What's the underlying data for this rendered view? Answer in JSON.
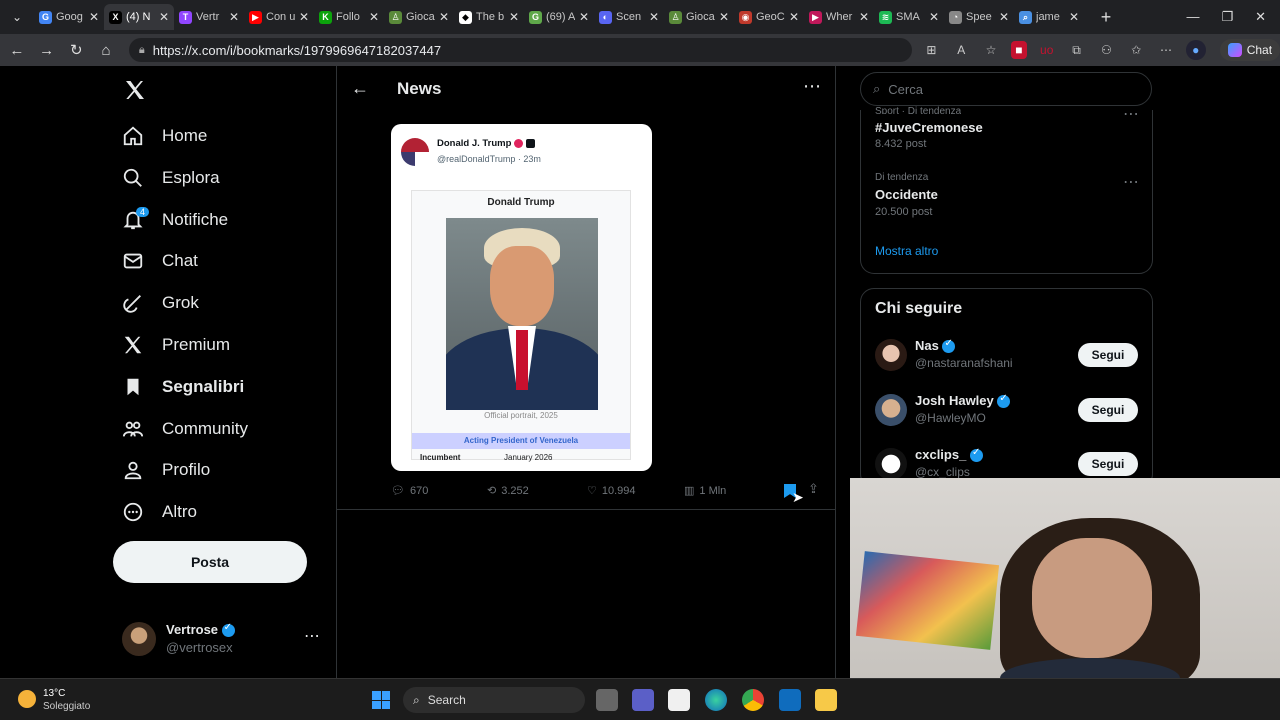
{
  "browser": {
    "tabs": [
      {
        "title": "Goog",
        "color": "#4285f4",
        "glyph": "G"
      },
      {
        "title": "(4) N",
        "color": "#000000",
        "glyph": "X",
        "active": true
      },
      {
        "title": "Vertr",
        "color": "#9146ff",
        "glyph": "T"
      },
      {
        "title": "Con u",
        "color": "#ff0000",
        "glyph": "▶"
      },
      {
        "title": "Follo",
        "color": "#0ca30c",
        "glyph": "K"
      },
      {
        "title": "Gioca",
        "color": "#5a8a3a",
        "glyph": "♙"
      },
      {
        "title": "The b",
        "color": "#ffffff",
        "glyph": "◆"
      },
      {
        "title": "(69) A",
        "color": "#5fa84a",
        "glyph": "G"
      },
      {
        "title": "Scen",
        "color": "#5865f2",
        "glyph": "◐"
      },
      {
        "title": "Gioca",
        "color": "#5a8a3a",
        "glyph": "♙"
      },
      {
        "title": "GeoC",
        "color": "#c0392b",
        "glyph": "◉"
      },
      {
        "title": "Wher",
        "color": "#c0185a",
        "glyph": "▶"
      },
      {
        "title": "SMA",
        "color": "#1db954",
        "glyph": "≋"
      },
      {
        "title": "Spee",
        "color": "#888888",
        "glyph": "◔"
      },
      {
        "title": "jame",
        "color": "#4a90e2",
        "glyph": "⌕"
      }
    ],
    "url": "https://x.com/i/bookmarks/1979969647182037447",
    "chat_label": "Chat"
  },
  "sidebar": {
    "items": [
      {
        "label": "Home",
        "icon": "home-icon"
      },
      {
        "label": "Esplora",
        "icon": "search-icon"
      },
      {
        "label": "Notifiche",
        "icon": "bell-icon",
        "badge": "4"
      },
      {
        "label": "Chat",
        "icon": "mail-icon"
      },
      {
        "label": "Grok",
        "icon": "grok-icon"
      },
      {
        "label": "Premium",
        "icon": "x-icon"
      },
      {
        "label": "Segnalibri",
        "icon": "bookmark-icon",
        "bold": true
      },
      {
        "label": "Community",
        "icon": "community-icon"
      },
      {
        "label": "Profilo",
        "icon": "profile-icon"
      },
      {
        "label": "Altro",
        "icon": "more-circle-icon"
      }
    ],
    "post_label": "Posta",
    "account": {
      "name": "Vertrose",
      "handle": "@vertrosex"
    }
  },
  "main": {
    "header_title": "News",
    "card": {
      "author": "Donald J. Trump",
      "handle": "@realDonaldTrump",
      "time": "23m",
      "inner_title": "Donald Trump",
      "caption": "Official portrait, 2025",
      "role": "Acting President of Venezuela",
      "row_label": "Incumbent",
      "row_value": "January 2026"
    },
    "metrics": {
      "replies": "670",
      "reposts": "3.252",
      "likes": "10.994",
      "views": "1 Mln"
    }
  },
  "right": {
    "search_placeholder": "Cerca",
    "trends": [
      {
        "context": "Sport · Di tendenza",
        "name": "#JuveCremonese",
        "posts": "8.432 post"
      },
      {
        "context": "Di tendenza",
        "name": "Occidente",
        "posts": "20.500 post"
      }
    ],
    "show_more": "Mostra altro",
    "follow_title": "Chi seguire",
    "follow": [
      {
        "name": "Nas",
        "handle": "@nastaranafshani",
        "button": "Segui"
      },
      {
        "name": "Josh Hawley",
        "handle": "@HawleyMO",
        "button": "Segui"
      },
      {
        "name": "cxclips_",
        "handle": "@cx_clips",
        "button": "Segui"
      }
    ]
  },
  "taskbar": {
    "weather_temp": "13°C",
    "weather_desc": "Soleggiato",
    "search_label": "Search"
  },
  "colors": {
    "accent": "#1d9bf0",
    "bg": "#000000",
    "border": "#2f3336"
  }
}
